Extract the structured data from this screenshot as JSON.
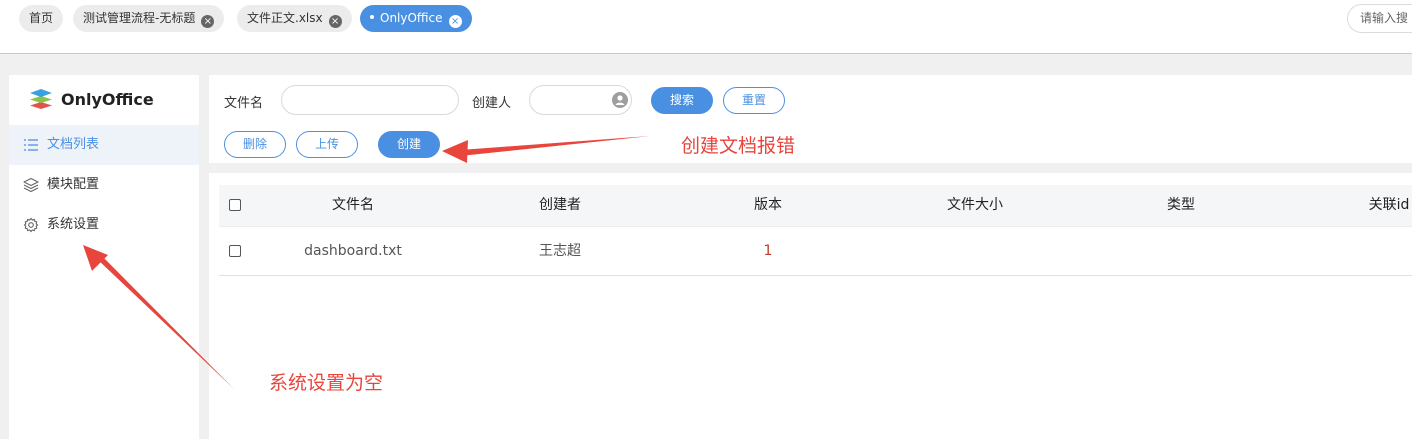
{
  "tabs": [
    {
      "label": "首页",
      "closable": false,
      "active": false
    },
    {
      "label": "测试管理流程-无标题",
      "closable": true,
      "active": false
    },
    {
      "label": "文件正文.xlsx",
      "closable": true,
      "active": false
    },
    {
      "label": "OnlyOffice",
      "closable": true,
      "active": true
    }
  ],
  "global_search": {
    "placeholder": "请输入搜"
  },
  "sidebar": {
    "app_name": "OnlyOffice",
    "items": [
      {
        "label": "文档列表",
        "icon": "list-icon",
        "active": true
      },
      {
        "label": "模块配置",
        "icon": "layers-icon",
        "active": false
      },
      {
        "label": "系统设置",
        "icon": "gear-icon",
        "active": false
      }
    ]
  },
  "filters": {
    "filename_label": "文件名",
    "filename_value": "",
    "creator_label": "创建人",
    "creator_value": "",
    "search_button": "搜索",
    "reset_button": "重置"
  },
  "actions": {
    "delete": "删除",
    "upload": "上传",
    "create": "创建"
  },
  "table": {
    "columns": [
      "文件名",
      "创建者",
      "版本",
      "文件大小",
      "类型",
      "关联id"
    ],
    "rows": [
      {
        "filename": "dashboard.txt",
        "creator": "王志超",
        "version": "1",
        "size": "",
        "type": "",
        "related_id": ""
      }
    ]
  },
  "annotations": {
    "create_error": "创建文档报错",
    "settings_empty": "系统设置为空",
    "color": "#e8453c"
  },
  "colors": {
    "accent": "#4a90e2",
    "annotation": "#e8453c"
  }
}
